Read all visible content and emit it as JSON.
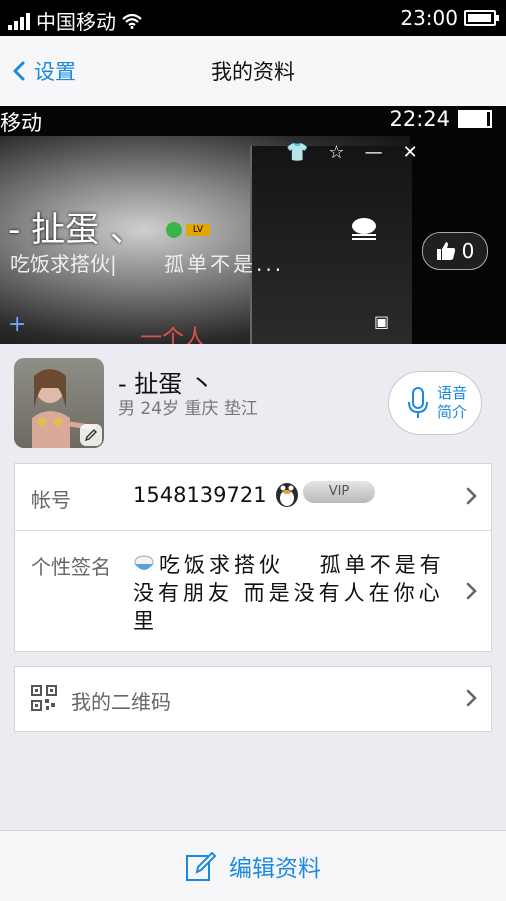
{
  "status_bar": {
    "carrier": "中国移动",
    "time": "23:00",
    "battery_level": 0.95
  },
  "nav": {
    "back_label": "设置",
    "title": "我的资料"
  },
  "cover": {
    "inner_carrier": "移动",
    "inner_time": "22:24",
    "name_text": "- 扯蛋 、",
    "sig_left": "吃饭求搭伙|",
    "sig_right": "孤单不是...",
    "bottom_text": "一个人",
    "like_count": "0"
  },
  "profile": {
    "name": "- 扯蛋 丶",
    "info": "男 24岁 重庆 垫江",
    "voice_line1": "语音",
    "voice_line2": "简介"
  },
  "account": {
    "label": "帐号",
    "value": "1548139721",
    "vip": "VIP"
  },
  "signature": {
    "label": "个性签名",
    "text": "吃饭求搭伙　 孤单不是有没有朋友 而是没有人在你心里"
  },
  "qrcode": {
    "label": "我的二维码"
  },
  "bottom": {
    "edit_label": "编辑资料"
  },
  "colors": {
    "accent": "#1a8ae0",
    "background": "#ebebf1"
  }
}
